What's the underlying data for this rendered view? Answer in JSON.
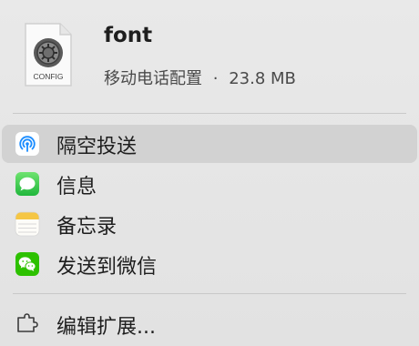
{
  "file": {
    "name": "font",
    "kind": "移动电话配置",
    "separator": "·",
    "size": "23.8 MB",
    "icon_name": "config-file-icon",
    "icon_badge": "CONFIG"
  },
  "menu": {
    "items": [
      {
        "label": "隔空投送",
        "icon": "airdrop-icon",
        "highlighted": true
      },
      {
        "label": "信息",
        "icon": "messages-icon",
        "highlighted": false
      },
      {
        "label": "备忘录",
        "icon": "notes-icon",
        "highlighted": false
      },
      {
        "label": "发送到微信",
        "icon": "wechat-icon",
        "highlighted": false
      }
    ],
    "extensions": {
      "label": "编辑扩展...",
      "icon": "extensions-icon"
    }
  },
  "colors": {
    "airdrop": "#1a8cff",
    "messages": "#34c759",
    "notes": "#f5c644",
    "wechat": "#2dc100",
    "highlight": "#d2d2d2"
  }
}
